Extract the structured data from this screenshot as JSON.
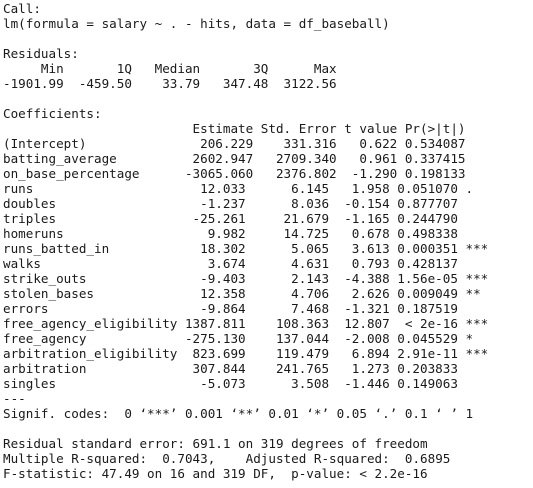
{
  "console": {
    "lines": [
      "Call:",
      "lm(formula = salary ~ . - hits, data = df_baseball)",
      "",
      "Residuals:",
      "     Min       1Q   Median       3Q      Max ",
      "-1901.99  -459.50    33.79   347.48  3122.56 ",
      "",
      "Coefficients:",
      "                         Estimate Std. Error t value Pr(>|t|)    ",
      "(Intercept)               206.229    331.316   0.622 0.534087    ",
      "batting_average          2602.947   2709.340   0.961 0.337415    ",
      "on_base_percentage      -3065.060   2376.802  -1.290 0.198133    ",
      "runs                      12.033      6.145   1.958 0.051070 .  ",
      "doubles                   -1.237      8.036  -0.154 0.877707    ",
      "triples                  -25.261     21.679  -1.165 0.244790    ",
      "homeruns                   9.982     14.725   0.678 0.498338    ",
      "runs_batted_in            18.302      5.065   3.613 0.000351 ***",
      "walks                      3.674      4.631   0.793 0.428137    ",
      "strike_outs               -9.403      2.143  -4.388 1.56e-05 ***",
      "stolen_bases              12.358      4.706   2.626 0.009049 ** ",
      "errors                    -9.864      7.468  -1.321 0.187519    ",
      "free_agency_eligibility 1387.811    108.363  12.807  < 2e-16 ***",
      "free_agency             -275.130    137.044  -2.008 0.045529 *  ",
      "arbitration_eligibility  823.699    119.479   6.894 2.91e-11 ***",
      "arbitration              307.844    241.765   1.273 0.203833    ",
      "singles                   -5.073      3.508  -1.446 0.149063    ",
      "---",
      "Signif. codes:  0 ‘***’ 0.001 ‘**’ 0.01 ‘*’ 0.05 ‘.’ 0.1 ‘ ’ 1",
      "",
      "Residual standard error: 691.1 on 319 degrees of freedom",
      "Multiple R-squared:  0.7043,\tAdjusted R-squared:  0.6895 ",
      "F-statistic: 47.49 on 16 and 319 DF,  p-value: < 2.2e-16"
    ]
  }
}
